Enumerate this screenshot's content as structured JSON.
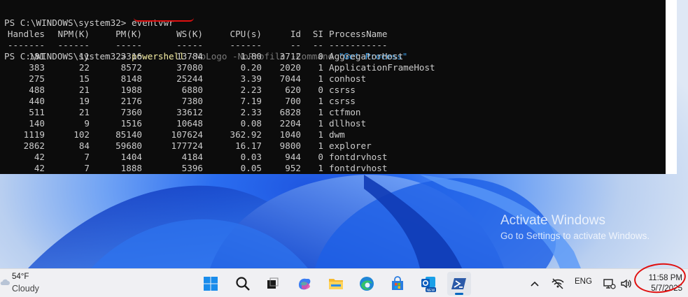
{
  "terminal": {
    "line_prev": "PS C:\\WINDOWS\\system32> eventvwr",
    "prompt": "PS C:\\WINDOWS\\system32> ",
    "command": "powershell",
    "arg1": " -NoLogo -NoProfile -Command ",
    "arg2": "\"Get-Process\"",
    "headers": [
      "Handles",
      "NPM(K)",
      "PM(K)",
      "WS(K)",
      "CPU(s)",
      "Id",
      "SI",
      "ProcessName"
    ],
    "dashes": [
      "-------",
      "------",
      "-----",
      "-----",
      "------",
      "--",
      "--",
      "-----------"
    ],
    "rows": [
      [
        "181",
        "11",
        "3316",
        "13784",
        "1.80",
        "3712",
        "0",
        "AggregatorHost"
      ],
      [
        "383",
        "22",
        "8572",
        "37080",
        "0.20",
        "2020",
        "1",
        "ApplicationFrameHost"
      ],
      [
        "275",
        "15",
        "8148",
        "25244",
        "3.39",
        "7044",
        "1",
        "conhost"
      ],
      [
        "488",
        "21",
        "1988",
        "6880",
        "2.23",
        "620",
        "0",
        "csrss"
      ],
      [
        "440",
        "19",
        "2176",
        "7380",
        "7.19",
        "700",
        "1",
        "csrss"
      ],
      [
        "511",
        "21",
        "7360",
        "33612",
        "2.33",
        "6828",
        "1",
        "ctfmon"
      ],
      [
        "140",
        "9",
        "1516",
        "10648",
        "0.08",
        "2204",
        "1",
        "dllhost"
      ],
      [
        "1119",
        "102",
        "85140",
        "107624",
        "362.92",
        "1040",
        "1",
        "dwm"
      ],
      [
        "2862",
        "84",
        "59680",
        "177724",
        "16.17",
        "9800",
        "1",
        "explorer"
      ],
      [
        "42",
        "7",
        "1404",
        "4184",
        "0.03",
        "944",
        "0",
        "fontdrvhost"
      ],
      [
        "42",
        "7",
        "1888",
        "5396",
        "0.05",
        "952",
        "1",
        "fontdrvhost"
      ]
    ]
  },
  "watermark": {
    "title": "Activate Windows",
    "subtitle": "Go to Settings to activate Windows."
  },
  "taskbar": {
    "weather_temp": "54°F",
    "weather_cond": "Cloudy",
    "apps": [
      "start-icon",
      "search-icon",
      "task-view-icon",
      "copilot-icon",
      "file-explorer-icon",
      "edge-icon",
      "store-icon",
      "outlook-new-icon",
      "powershell-icon"
    ],
    "language": "ENG",
    "time": "11:58 PM",
    "date": "5/7/2025"
  },
  "colors": {
    "terminal_bg": "#0c0c0c",
    "terminal_text": "#cccccc",
    "command": "#f9f1a5",
    "string": "#3b9ee8",
    "annotation": "#e01010",
    "accent": "#0067c0"
  }
}
